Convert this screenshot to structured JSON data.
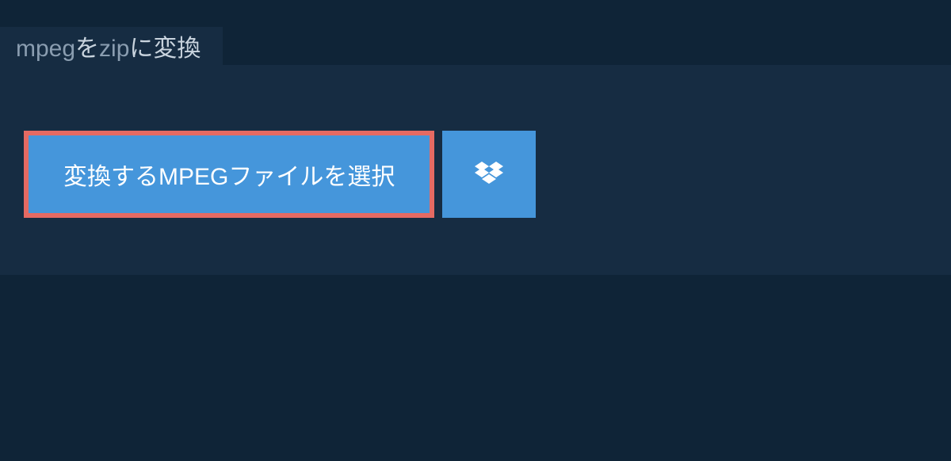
{
  "tab": {
    "source_format": "mpeg",
    "middle_text": "を",
    "target_format": "zip",
    "suffix_text": "に変換"
  },
  "buttons": {
    "select_file_label": "変換するMPEGファイルを選択"
  },
  "colors": {
    "background": "#0f2437",
    "panel": "#162c42",
    "button": "#4596db",
    "button_border": "#e56a63",
    "text_light": "#c9d4de",
    "text_muted": "#8a9db0"
  }
}
